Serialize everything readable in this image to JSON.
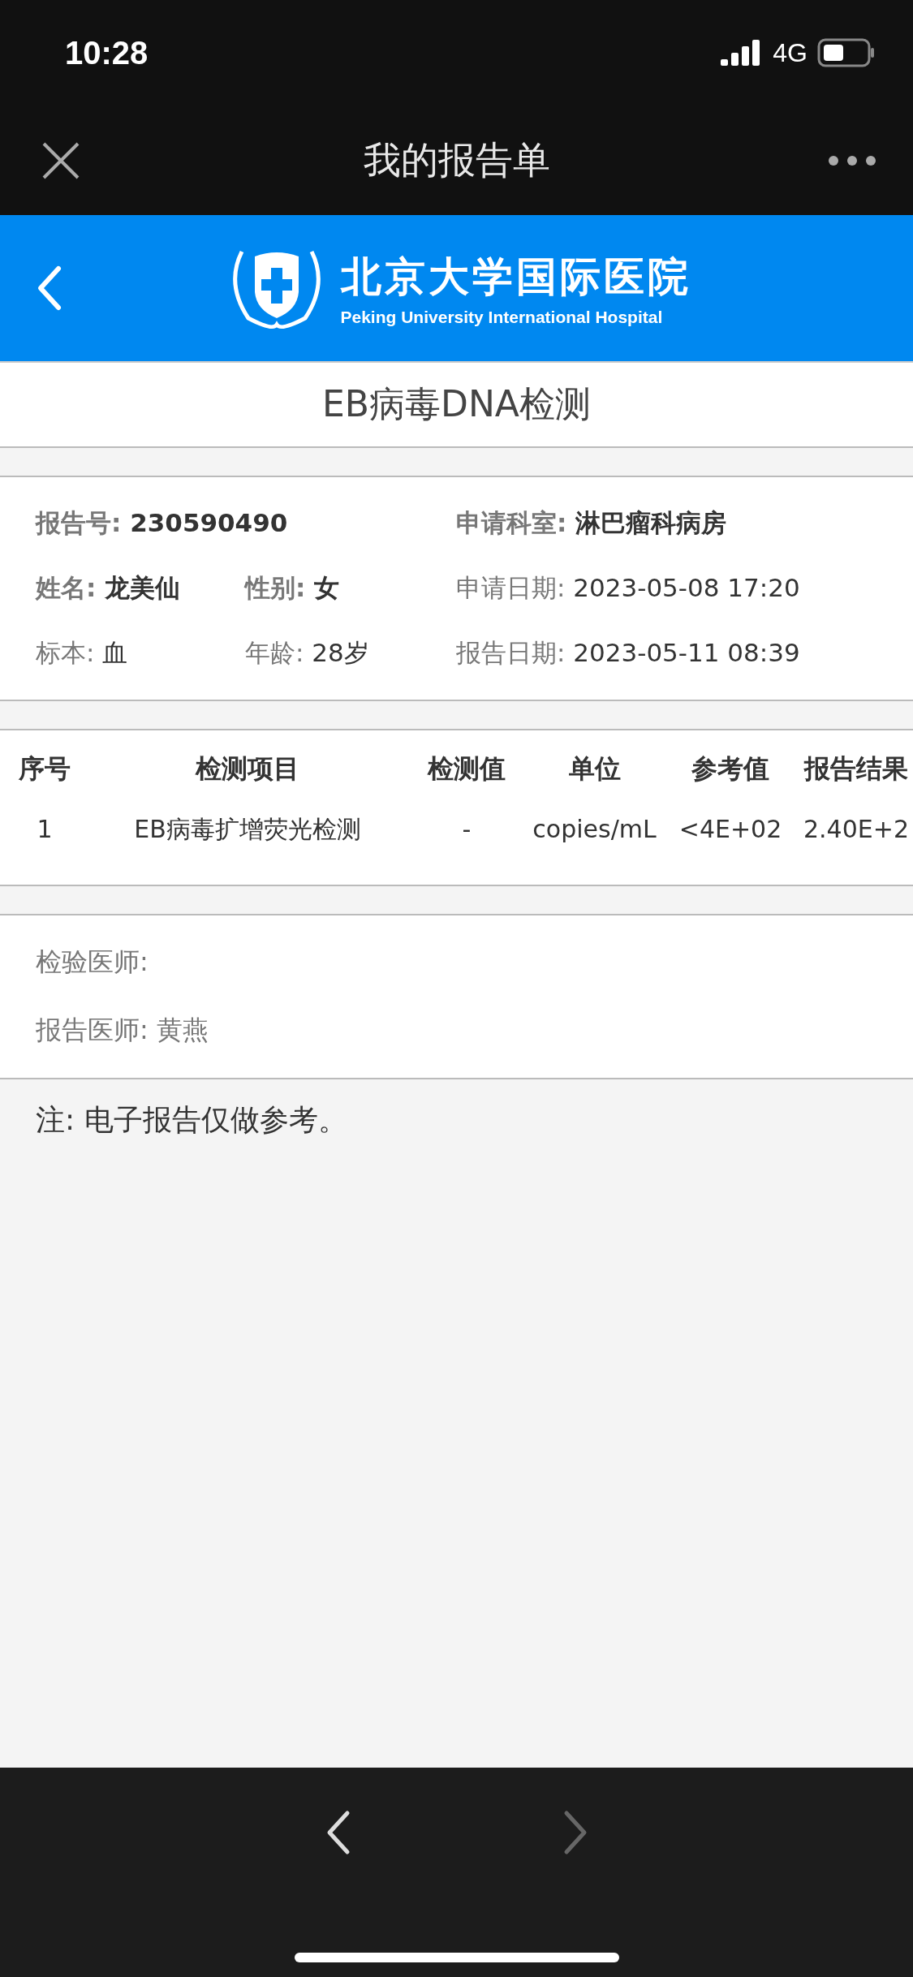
{
  "status_bar": {
    "time": "10:28",
    "network": "4G"
  },
  "nav_bar": {
    "title": "我的报告单"
  },
  "header": {
    "name_zh": "北京大学国际医院",
    "name_en": "Peking University International Hospital"
  },
  "report_title": "EB病毒DNA检测",
  "info": [
    [
      {
        "label": "报告号:",
        "value": "230590490",
        "bold": true
      },
      {
        "label": "申请科室:",
        "value": "淋巴瘤科病房",
        "bold": true
      }
    ],
    [
      {
        "label": "姓名:",
        "value": "龙美仙",
        "bold": true
      },
      {
        "label": "性别:",
        "value": "女",
        "bold": true
      },
      {
        "label": "申请日期:",
        "value": "2023-05-08 17:20",
        "bold": false
      }
    ],
    [
      {
        "label": "标本:",
        "value": "血",
        "bold": false
      },
      {
        "label": "年龄:",
        "value": "28岁",
        "bold": false
      },
      {
        "label": "报告日期:",
        "value": "2023-05-11 08:39",
        "bold": false
      }
    ]
  ],
  "table": {
    "columns": [
      "序号",
      "检测项目",
      "检测值",
      "单位",
      "参考值",
      "报告结果"
    ],
    "rows": [
      [
        "1",
        "EB病毒扩增荧光检测",
        "-",
        "copies/mL",
        "<4E+02",
        "2.40E+2"
      ]
    ]
  },
  "doctors": [
    "检验医师:",
    "报告医师: 黄燕"
  ],
  "note": "注: 电子报告仅做参考。",
  "bottom_nav": [
    {
      "kind": "back",
      "disabled": false
    },
    {
      "kind": "forward",
      "disabled": true
    }
  ]
}
